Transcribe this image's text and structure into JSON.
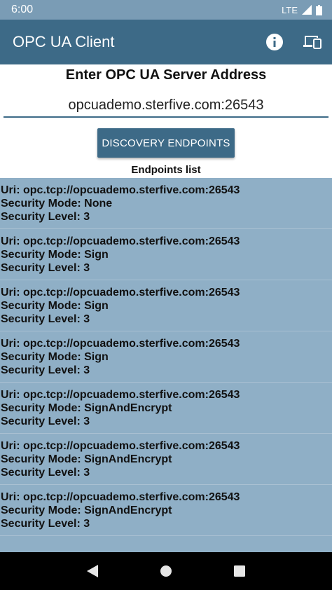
{
  "status_bar": {
    "time": "6:00",
    "network": "LTE"
  },
  "app_bar": {
    "title": "OPC UA Client",
    "info_icon": "info-icon",
    "devices_icon": "devices-icon"
  },
  "server": {
    "label": "Enter OPC UA Server Address",
    "address": "opcuademo.sterfive.com:26543"
  },
  "discover_button": "DISCOVERY ENDPOINTS",
  "endpoints_label": "Endpoints list",
  "endpoints": [
    {
      "uri": "Uri: opc.tcp://opcuademo.sterfive.com:26543",
      "mode": "Security Mode: None",
      "level": "Security Level: 3"
    },
    {
      "uri": "Uri: opc.tcp://opcuademo.sterfive.com:26543",
      "mode": "Security Mode: Sign",
      "level": "Security Level: 3"
    },
    {
      "uri": "Uri: opc.tcp://opcuademo.sterfive.com:26543",
      "mode": "Security Mode: Sign",
      "level": "Security Level: 3"
    },
    {
      "uri": "Uri: opc.tcp://opcuademo.sterfive.com:26543",
      "mode": "Security Mode: Sign",
      "level": "Security Level: 3"
    },
    {
      "uri": "Uri: opc.tcp://opcuademo.sterfive.com:26543",
      "mode": "Security Mode: SignAndEncrypt",
      "level": "Security Level: 3"
    },
    {
      "uri": "Uri: opc.tcp://opcuademo.sterfive.com:26543",
      "mode": "Security Mode: SignAndEncrypt",
      "level": "Security Level: 3"
    },
    {
      "uri": "Uri: opc.tcp://opcuademo.sterfive.com:26543",
      "mode": "Security Mode: SignAndEncrypt",
      "level": "Security Level: 3"
    }
  ],
  "colors": {
    "status_bar": "#7a9cb5",
    "app_bar": "#3d6a87",
    "list_background": "#8fafc6",
    "button": "#3d6a87"
  },
  "nav_bar": {
    "back_icon": "back-triangle-icon",
    "home_icon": "home-circle-icon",
    "recents_icon": "recents-square-icon"
  }
}
